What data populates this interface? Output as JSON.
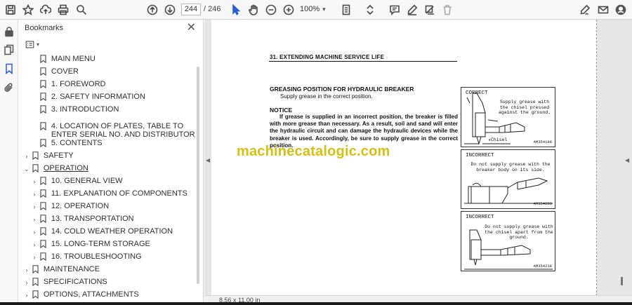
{
  "toolbar": {
    "page_current": "244",
    "page_total": "/ 246",
    "zoom": "100%"
  },
  "bookmarks": {
    "title": "Bookmarks",
    "close": "✕",
    "items": [
      {
        "label": "MAIN MENU",
        "twisty": "",
        "underline": false
      },
      {
        "label": "COVER",
        "twisty": "",
        "underline": false
      },
      {
        "label": "1.  FOREWORD",
        "twisty": "",
        "underline": false
      },
      {
        "label": "2.  SAFETY INFORMATION",
        "twisty": "",
        "underline": false
      },
      {
        "label": "3.  INTRODUCTION",
        "twisty": "",
        "underline": false
      },
      {
        "label": "4.  LOCATION OF PLATES, TABLE TO ENTER SERIAL NO. AND DISTRIBUTOR",
        "twisty": "",
        "underline": false
      },
      {
        "label": "5.  CONTENTS",
        "twisty": "",
        "underline": false
      },
      {
        "label": "SAFETY",
        "twisty": "›",
        "underline": false
      },
      {
        "label": "OPERATION",
        "twisty": "⌄",
        "underline": true
      },
      {
        "label": "10.  GENERAL VIEW",
        "twisty": "›",
        "underline": false
      },
      {
        "label": "11.  EXPLANATION OF COMPONENTS",
        "twisty": "›",
        "underline": false
      },
      {
        "label": "12.  OPERATION",
        "twisty": "›",
        "underline": false
      },
      {
        "label": "13.  TRANSPORTATION",
        "twisty": "›",
        "underline": false
      },
      {
        "label": "14.  COLD WEATHER OPERATION",
        "twisty": "›",
        "underline": false
      },
      {
        "label": "15.  LONG-TERM STORAGE",
        "twisty": "›",
        "underline": false
      },
      {
        "label": "16.  TROUBLESHOOTING",
        "twisty": "›",
        "underline": false
      },
      {
        "label": "MAINTENANCE",
        "twisty": "›",
        "underline": false
      },
      {
        "label": "SPECIFICATIONS",
        "twisty": "›",
        "underline": false
      },
      {
        "label": "OPTIONS, ATTACHMENTS",
        "twisty": "›",
        "underline": false
      }
    ]
  },
  "page": {
    "header": "31.  EXTENDING  MACHINE SERVICE LIFE",
    "heading": "GREASING POSITION FOR HYDRAULIC BREAKER",
    "instruction": "Supply grease in the correct position.",
    "notice_title": "NOTICE",
    "notice_body": "If grease is supplied in an incorrect position, the breaker is filled with more grease than necessary. As a result, soil and sand will enter the hydraulic circuit and can damage the hydraulic devices while the breaker is used. Accordingly, be sure to supply grease in the correct position.",
    "watermark": "machinecatalogic.com",
    "figures": [
      {
        "caption": "CORRECT",
        "note": "Supply grease with the chisel pressed against the ground.",
        "label": "Chisel",
        "code": "AM354198"
      },
      {
        "caption": "INCORRECT",
        "note": "Do not supply grease with the breaker body on its side.",
        "label": "",
        "code": "AM354208"
      },
      {
        "caption": "INCORRECT",
        "note": "Do not supply grease with the chisel apart from the ground.",
        "label": "",
        "code": "AM354218"
      }
    ],
    "size": "8,56 x 11,00 in"
  }
}
